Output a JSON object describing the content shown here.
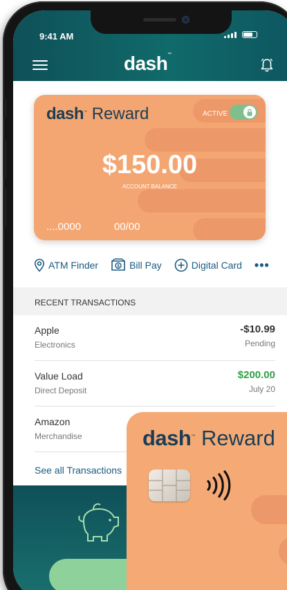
{
  "status": {
    "time": "9:41 AM"
  },
  "header": {
    "logo": "dash"
  },
  "card": {
    "brand_bold": "dash",
    "brand_light": "Reward",
    "status_label": "ACTIVE",
    "balance": "$150.00",
    "balance_label": "ACCOUNT BALANCE",
    "card_number": "....0000",
    "expiry": "00/00",
    "active": true
  },
  "actions": [
    {
      "label": "ATM Finder",
      "icon": "location-pin-icon"
    },
    {
      "label": "Bill Pay",
      "icon": "bill-pay-icon"
    },
    {
      "label": "Digital Card",
      "icon": "plus-circle-icon"
    },
    {
      "label": "•••",
      "icon": "more-icon"
    }
  ],
  "transactions": {
    "heading": "RECENT TRANSACTIONS",
    "items": [
      {
        "name": "Apple",
        "category": "Electronics",
        "amount": "-$10.99",
        "status": "Pending",
        "color": "#333333"
      },
      {
        "name": "Value Load",
        "category": "Direct Deposit",
        "amount": "$200.00",
        "status": "July 20",
        "color": "#2ea043"
      },
      {
        "name": "Amazon",
        "category": "Merchandise",
        "amount": "",
        "status": "",
        "color": "#333333"
      }
    ],
    "see_all": "See all Transactions"
  },
  "physical_card": {
    "brand_bold": "dash",
    "brand_light": "Reward"
  },
  "colors": {
    "header": "#0f5058",
    "card": "#f4a672",
    "link": "#1a5a82",
    "positive": "#2ea043",
    "toggle": "#7fbf8e"
  }
}
